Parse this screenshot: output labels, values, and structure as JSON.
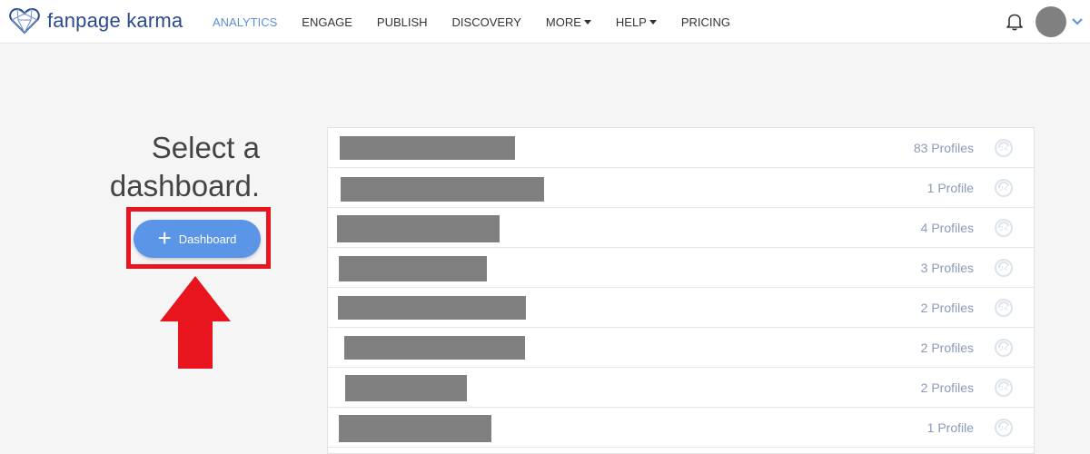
{
  "brand": {
    "name": "fanpage karma",
    "logo_icon": "heart-network-icon"
  },
  "nav": {
    "items": [
      {
        "label": "ANALYTICS",
        "active": true,
        "dropdown": false
      },
      {
        "label": "ENGAGE",
        "active": false,
        "dropdown": false
      },
      {
        "label": "PUBLISH",
        "active": false,
        "dropdown": false
      },
      {
        "label": "DISCOVERY",
        "active": false,
        "dropdown": false
      },
      {
        "label": "MORE",
        "active": false,
        "dropdown": true
      },
      {
        "label": "HELP",
        "active": false,
        "dropdown": true
      },
      {
        "label": "PRICING",
        "active": false,
        "dropdown": false
      }
    ]
  },
  "header": {
    "notification_icon": "bell-icon",
    "account_menu_icon": "chevron-down-icon"
  },
  "main": {
    "title_line1": "Select a",
    "title_line2": "dashboard.",
    "add_button_label": "Dashboard",
    "add_button_icon": "plus-icon",
    "annotation_color": "#e8141e"
  },
  "dashboards": {
    "rows": [
      {
        "profiles": "83 Profiles"
      },
      {
        "profiles": "1 Profile"
      },
      {
        "profiles": "4 Profiles"
      },
      {
        "profiles": "3 Profiles"
      },
      {
        "profiles": "2 Profiles"
      },
      {
        "profiles": "2 Profiles"
      },
      {
        "profiles": "2 Profiles"
      },
      {
        "profiles": "1 Profile"
      }
    ],
    "row_icon": "sync-24-icon"
  },
  "colors": {
    "accent": "#5b95e8",
    "brand": "#2a4a8c",
    "muted_text": "#8a9bb8"
  }
}
